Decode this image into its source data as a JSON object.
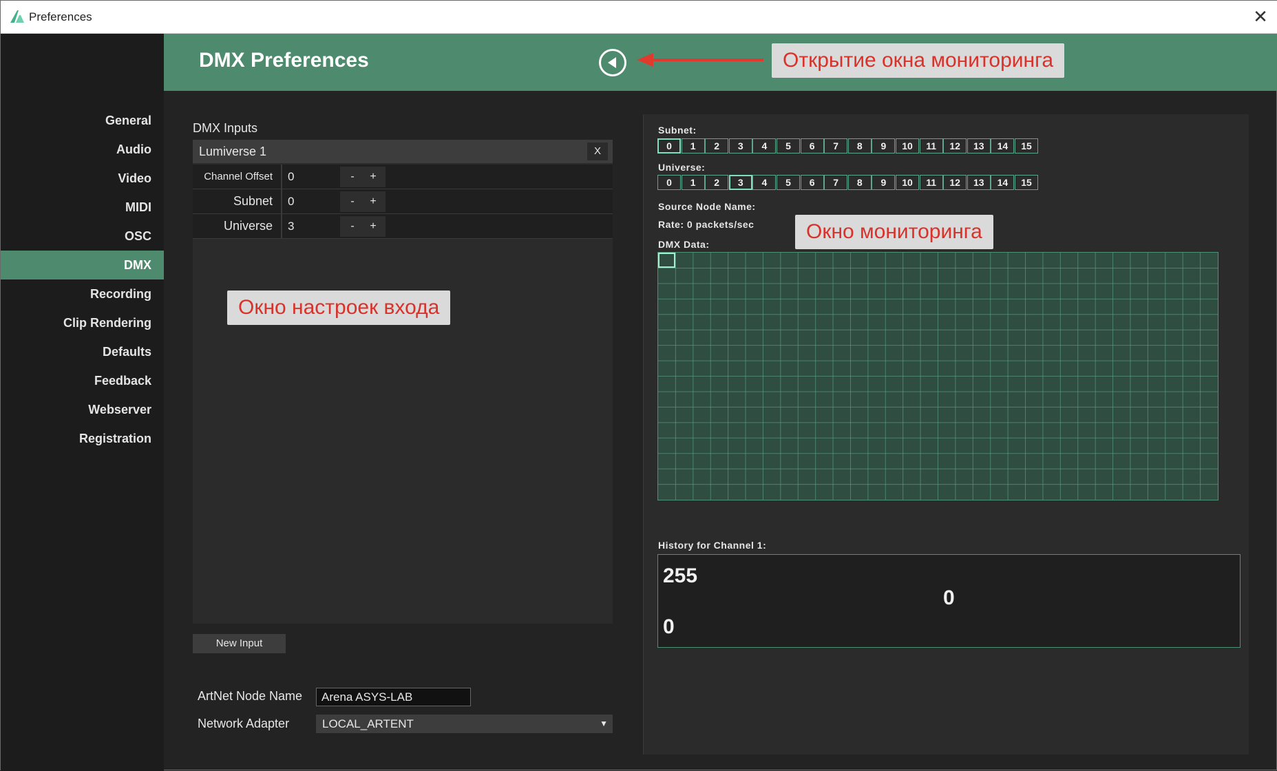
{
  "window": {
    "title": "Preferences",
    "close_glyph": "✕"
  },
  "sidebar": {
    "items": [
      {
        "label": "General",
        "active": false
      },
      {
        "label": "Audio",
        "active": false
      },
      {
        "label": "Video",
        "active": false
      },
      {
        "label": "MIDI",
        "active": false
      },
      {
        "label": "OSC",
        "active": false
      },
      {
        "label": "DMX",
        "active": true
      },
      {
        "label": "Recording",
        "active": false
      },
      {
        "label": "Clip Rendering",
        "active": false
      },
      {
        "label": "Defaults",
        "active": false
      },
      {
        "label": "Feedback",
        "active": false
      },
      {
        "label": "Webserver",
        "active": false
      },
      {
        "label": "Registration",
        "active": false
      }
    ]
  },
  "header": {
    "title": "DMX Preferences",
    "toggle_icon": "play-left-icon"
  },
  "annotations": {
    "monitor_open": "Открытие окна мониторинга",
    "monitor_window": "Окно мониторинга",
    "input_settings": "Окно настроек входа"
  },
  "inputs": {
    "section_label": "DMX Inputs",
    "lumiverse": {
      "title": "Lumiverse 1",
      "close_label": "X",
      "params": [
        {
          "label": "Channel Offset",
          "value": "0"
        },
        {
          "label": "Subnet",
          "value": "0"
        },
        {
          "label": "Universe",
          "value": "3"
        }
      ],
      "minus_label": "-",
      "plus_label": "+"
    },
    "new_input_label": "New Input",
    "artnet_label": "ArtNet Node Name",
    "artnet_value": "Arena ASYS-LAB",
    "adapter_label": "Network Adapter",
    "adapter_value": "LOCAL_ARTENT",
    "adapter_arrow": "▼"
  },
  "monitor": {
    "subnet_label": "Subnet:",
    "universe_label": "Universe:",
    "selector_values": [
      "0",
      "1",
      "2",
      "3",
      "4",
      "5",
      "6",
      "7",
      "8",
      "9",
      "10",
      "11",
      "12",
      "13",
      "14",
      "15"
    ],
    "selected_subnet": 0,
    "selected_universe": 3,
    "source_node_label": "Source Node Name:",
    "rate_label": "Rate: 0 packets/sec",
    "dmx_data_label": "DMX Data:",
    "grid_cols": 32,
    "grid_rows": 16,
    "history_label": "History for Channel 1:",
    "history_max": "255",
    "history_min": "0",
    "history_current": "0"
  },
  "colors": {
    "accent": "#4e8a6e",
    "annotation_text": "#d8322a",
    "grid_line": "#5ea68c"
  }
}
